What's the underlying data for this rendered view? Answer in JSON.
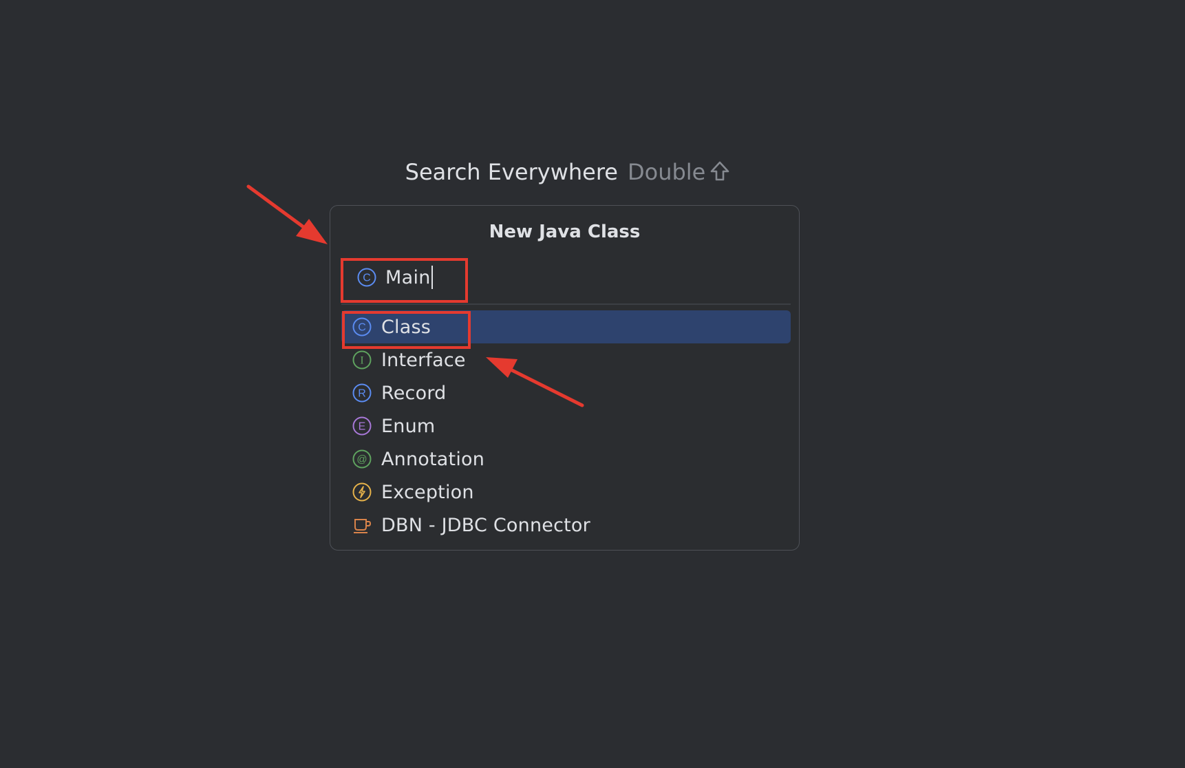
{
  "hint": {
    "title": "Search Everywhere",
    "shortcut": "Double",
    "shortcut_icon": "shift-key-icon"
  },
  "dialog": {
    "title": "New Java Class",
    "name_field": {
      "value": "Main",
      "icon": "class-icon"
    },
    "kinds": [
      {
        "label": "Class",
        "icon": "class-icon",
        "selected": true
      },
      {
        "label": "Interface",
        "icon": "interface-icon",
        "selected": false
      },
      {
        "label": "Record",
        "icon": "record-icon",
        "selected": false
      },
      {
        "label": "Enum",
        "icon": "enum-icon",
        "selected": false
      },
      {
        "label": "Annotation",
        "icon": "annotation-icon",
        "selected": false
      },
      {
        "label": "Exception",
        "icon": "exception-icon",
        "selected": false
      },
      {
        "label": "DBN - JDBC Connector",
        "icon": "jdbc-connector-icon",
        "selected": false
      }
    ]
  },
  "colors": {
    "background": "#2b2d31",
    "dialog_border": "#4e5157",
    "selection": "#2e436e",
    "annotation_red": "#e53a2f",
    "class_blue": "#5b8cf2",
    "interface_green": "#5fa35f",
    "enum_purple": "#a878d8",
    "exception_yellow": "#e6b24a",
    "connector_orange": "#d9834a"
  }
}
